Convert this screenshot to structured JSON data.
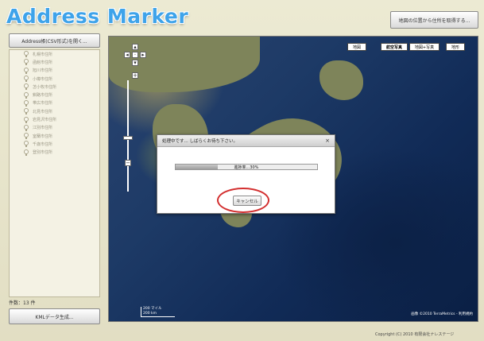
{
  "header": {
    "app_title": "Address Marker",
    "top_button": "地図の位置から住所を取得する..."
  },
  "sidebar": {
    "open_button": "Address帳(CSV形式)を開く...",
    "items": [
      {
        "label": "札幌市住所"
      },
      {
        "label": "函館市住所"
      },
      {
        "label": "旭川市住所"
      },
      {
        "label": "小樽市住所"
      },
      {
        "label": "苫小牧市住所"
      },
      {
        "label": "釧路市住所"
      },
      {
        "label": "帯広市住所"
      },
      {
        "label": "北見市住所"
      },
      {
        "label": "岩見沢市住所"
      },
      {
        "label": "江別市住所"
      },
      {
        "label": "室蘭市住所"
      },
      {
        "label": "千歳市住所"
      },
      {
        "label": "登別市住所"
      }
    ],
    "count_label": "件数：13 件",
    "kml_button": "KMLデータ生成..."
  },
  "map": {
    "type_buttons": [
      {
        "label": "地図",
        "active": false
      },
      {
        "label": "航空写真",
        "active": true
      },
      {
        "label": "地図+写真",
        "active": false
      },
      {
        "label": "地形",
        "active": false
      }
    ],
    "scale_text_top": "200 マイル",
    "scale_text_bottom": "200 km",
    "attribution": "画像 ©2010 TerraMetrics - 利用規約"
  },
  "dialog": {
    "title": "処理中です... しばらくお待ち下さい。",
    "close_label": "×",
    "progress_text": "進捗率...30%",
    "progress_value": 0.3,
    "cancel_label": "キャンセル"
  },
  "footer": {
    "copyright": "Copyright (C) 2010 有限会社ナレステージ"
  },
  "colors": {
    "logo": "#3ea3ea",
    "background": "#e8e4cc",
    "highlight": "#d32f2f"
  }
}
